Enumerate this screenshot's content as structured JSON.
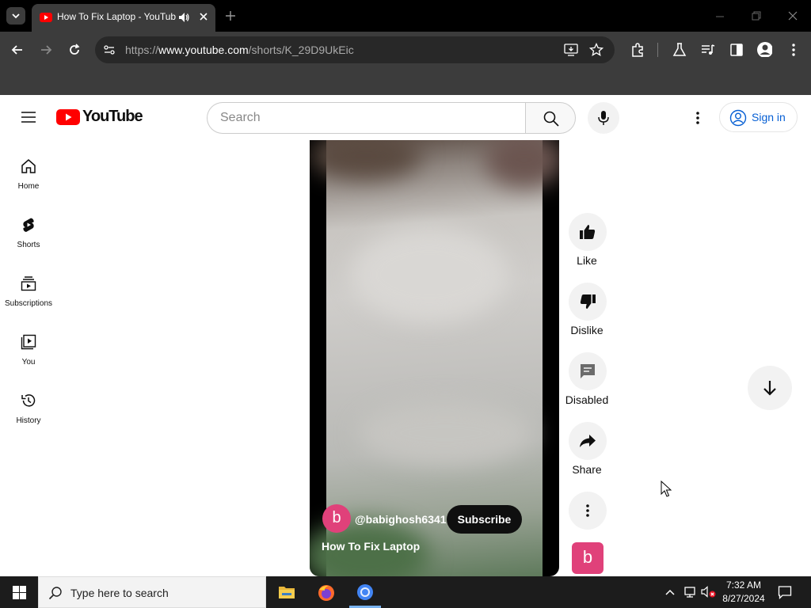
{
  "browser": {
    "tab_title": "How To Fix Laptop - YouTube",
    "url_prefix": "https://",
    "url_domain": "www.youtube.com",
    "url_path": "/shorts/K_29D9UkEic"
  },
  "header": {
    "logo_text": "YouTube",
    "search_placeholder": "Search",
    "sign_in_label": "Sign in"
  },
  "sidebar": {
    "items": [
      {
        "label": "Home",
        "icon": "home-icon"
      },
      {
        "label": "Shorts",
        "icon": "shorts-icon"
      },
      {
        "label": "Subscriptions",
        "icon": "subscriptions-icon"
      },
      {
        "label": "You",
        "icon": "you-icon"
      },
      {
        "label": "History",
        "icon": "history-icon"
      }
    ]
  },
  "video": {
    "channel_initial": "b",
    "channel_name": "@babighosh6341",
    "subscribe_label": "Subscribe",
    "title": "How To Fix Laptop"
  },
  "actions": {
    "like_label": "Like",
    "dislike_label": "Dislike",
    "comments_label": "Disabled",
    "share_label": "Share",
    "avatar_initial": "b"
  },
  "taskbar": {
    "search_placeholder": "Type here to search",
    "time": "7:32 AM",
    "date": "8/27/2024"
  },
  "colors": {
    "youtube_red": "#ff0000",
    "link_blue": "#065fd4",
    "avatar_pink": "#e0417a"
  }
}
